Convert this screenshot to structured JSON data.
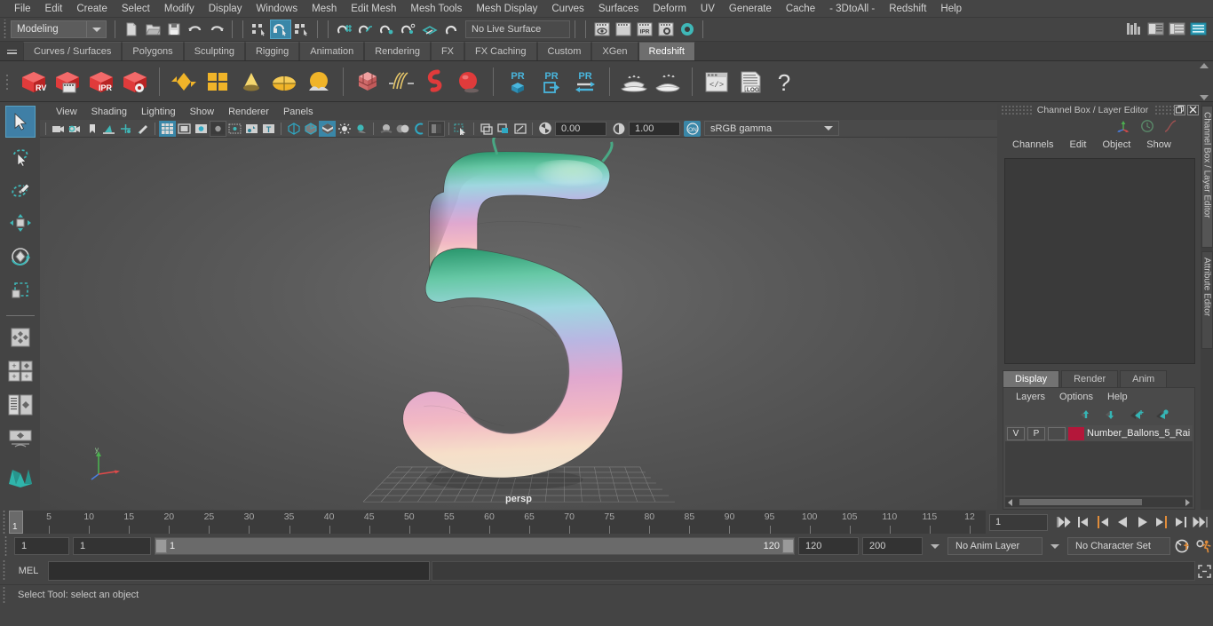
{
  "app": {
    "title": "Autodesk Maya",
    "menus": [
      "File",
      "Edit",
      "Create",
      "Select",
      "Modify",
      "Display",
      "Windows",
      "Mesh",
      "Edit Mesh",
      "Mesh Tools",
      "Mesh Display",
      "Curves",
      "Surfaces",
      "Deform",
      "UV",
      "Generate",
      "Cache",
      "- 3DtoAll -",
      "Redshift",
      "Help"
    ]
  },
  "statusbar": {
    "mode": "Modeling",
    "live_surface": "No Live Surface",
    "icons": [
      "new-scene-icon",
      "open-scene-icon",
      "save-scene-icon",
      "undo-icon",
      "redo-icon",
      "select-by-hierarchy-icon",
      "select-by-object-icon",
      "select-by-component-icon",
      "snap-to-grid-icon",
      "snap-to-curve-icon",
      "snap-to-point-icon",
      "snap-to-projected-center-icon",
      "snap-to-view-plane-icon",
      "make-live-icon",
      "render-view-icon",
      "render-current-frame-icon",
      "ipr-render-icon",
      "render-settings-icon",
      "hypershade-icon"
    ],
    "right_icons": [
      "show-hide-modeling-toolkit-icon",
      "show-hide-attribute-editor-icon",
      "show-hide-tool-settings-icon",
      "show-hide-channel-box-icon"
    ]
  },
  "shelf": {
    "tabs": [
      "Curves / Surfaces",
      "Polygons",
      "Sculpting",
      "Rigging",
      "Animation",
      "Rendering",
      "FX",
      "FX Caching",
      "Custom",
      "XGen",
      "Redshift"
    ],
    "active_tab": "Redshift",
    "buttons": [
      {
        "name": "redshift-render-view",
        "label": "RV"
      },
      {
        "name": "redshift-render-sequence",
        "label": ""
      },
      {
        "name": "redshift-ipr-render",
        "label": "IPR"
      },
      {
        "name": "redshift-render-settings",
        "label": ""
      },
      {
        "name": "redshift-material-icon",
        "label": ""
      },
      {
        "name": "redshift-material-blender-icon",
        "label": ""
      },
      {
        "name": "redshift-light-icon",
        "label": ""
      },
      {
        "name": "redshift-dome-light-icon",
        "label": ""
      },
      {
        "name": "redshift-environment-icon",
        "label": ""
      },
      {
        "name": "redshift-proxy-icon",
        "label": ""
      },
      {
        "name": "redshift-hair-icon",
        "label": ""
      },
      {
        "name": "redshift-volume-icon",
        "label": ""
      },
      {
        "name": "redshift-sphere-icon",
        "label": ""
      },
      {
        "name": "redshift-pr-bake-icon",
        "label": "PR"
      },
      {
        "name": "redshift-pr-export-icon",
        "label": "PR"
      },
      {
        "name": "redshift-pr-transfer-icon",
        "label": "PR"
      },
      {
        "name": "redshift-bake-set-icon",
        "label": ""
      },
      {
        "name": "redshift-bake-all-icon",
        "label": ""
      },
      {
        "name": "redshift-script-editor-icon",
        "label": ""
      },
      {
        "name": "redshift-log-icon",
        "label": ".LOG"
      },
      {
        "name": "redshift-help-icon",
        "label": "?"
      }
    ]
  },
  "toolbox": {
    "items": [
      {
        "name": "select-tool",
        "active": true
      },
      {
        "name": "lasso-select-tool",
        "active": false
      },
      {
        "name": "paint-select-tool",
        "active": false
      },
      {
        "name": "move-tool",
        "active": false
      },
      {
        "name": "rotate-tool",
        "active": false
      },
      {
        "name": "scale-tool",
        "active": false
      },
      {
        "name": "last-tool-used",
        "active": false
      },
      {
        "name": "single-perspective-view-layout",
        "active": false
      },
      {
        "name": "four-view-layout",
        "active": false
      },
      {
        "name": "outliner-persp-layout",
        "active": false
      },
      {
        "name": "hypergraph-persp-layout",
        "active": false
      },
      {
        "name": "maya-logo",
        "active": false
      }
    ]
  },
  "viewport": {
    "menus": [
      "View",
      "Shading",
      "Lighting",
      "Show",
      "Renderer",
      "Panels"
    ],
    "camera_label": "persp",
    "toolbar": {
      "exposure": "0.00",
      "gamma_value": "1.00",
      "color_management_toggle": "ON",
      "view_transform": "sRGB gamma",
      "icons": [
        "select-camera-icon",
        "camera-attributes-icon",
        "bookmark-icon",
        "image-plane-icon",
        "two-d-pan-zoom-icon",
        "grease-pencil-icon",
        "grid-toggle-icon",
        "film-gate-icon",
        "resolution-gate-icon",
        "gate-mask-icon",
        "field-chart-icon",
        "safe-action-icon",
        "safe-title-icon",
        "wireframe-icon",
        "smooth-shade-all-icon",
        "textured-icon",
        "use-default-lighting-icon",
        "shadows-icon",
        "screen-space-ambient-occlusion-icon",
        "motion-blur-icon",
        "multisample-anti-aliasing-icon",
        "depth-of-field-icon",
        "isolate-select-icon",
        "xray-toggle-icon",
        "xray-joints-icon",
        "xray-active-components-icon",
        "exposure-icon",
        "gamma-icon"
      ]
    }
  },
  "right_panel": {
    "title": "Channel Box / Layer Editor",
    "window_buttons": [
      "undock-icon",
      "close-icon"
    ],
    "header_icons": [
      "axis-gizmo-icon",
      "clock-icon",
      "curve-icon"
    ],
    "menus": [
      "Channels",
      "Edit",
      "Object",
      "Show"
    ],
    "side_tabs": [
      "Channel Box / Layer Editor",
      "Attribute Editor"
    ],
    "layer_editor": {
      "tabs": [
        "Display",
        "Render",
        "Anim"
      ],
      "active_tab": "Display",
      "menus": [
        "Layers",
        "Options",
        "Help"
      ],
      "toolbar_icons": [
        "move-layer-up-icon",
        "move-layer-down-icon",
        "new-layer-icon",
        "new-layer-from-selected-icon"
      ],
      "layers": [
        {
          "visibility": "V",
          "playback": "P",
          "type": "",
          "color": "#b4173a",
          "name": "Number_Ballons_5_Rai"
        }
      ]
    }
  },
  "timeslider": {
    "current_frame": "1",
    "frame_field": "1",
    "ticks": [
      5,
      10,
      15,
      20,
      25,
      30,
      35,
      40,
      45,
      50,
      55,
      60,
      65,
      70,
      75,
      80,
      85,
      90,
      95,
      100,
      105,
      110,
      115,
      120
    ],
    "tick_labels": [
      "5",
      "10",
      "15",
      "20",
      "25",
      "30",
      "35",
      "40",
      "45",
      "50",
      "55",
      "60",
      "65",
      "70",
      "75",
      "80",
      "85",
      "90",
      "95",
      "100",
      "105",
      "110",
      "115",
      "12"
    ],
    "playback_icons": [
      "go-to-start-icon",
      "step-back-keyframe-icon",
      "step-back-frame-icon",
      "play-backwards-icon",
      "play-forwards-icon",
      "step-forward-frame-icon",
      "step-forward-keyframe-icon",
      "go-to-end-icon"
    ]
  },
  "range": {
    "anim_start": "1",
    "playback_start": "1",
    "slider_min_label": "1",
    "slider_max_label": "120",
    "playback_end": "120",
    "anim_end": "200",
    "anim_layer": "No Anim Layer",
    "character_set": "No Character Set",
    "right_icons": [
      "auto-keyframe-icon",
      "animation-preferences-icon"
    ]
  },
  "command_line": {
    "language": "MEL",
    "input_value": "",
    "script_editor_icon": "script-editor-icon"
  },
  "statusline": {
    "message": "Select Tool: select an object"
  }
}
